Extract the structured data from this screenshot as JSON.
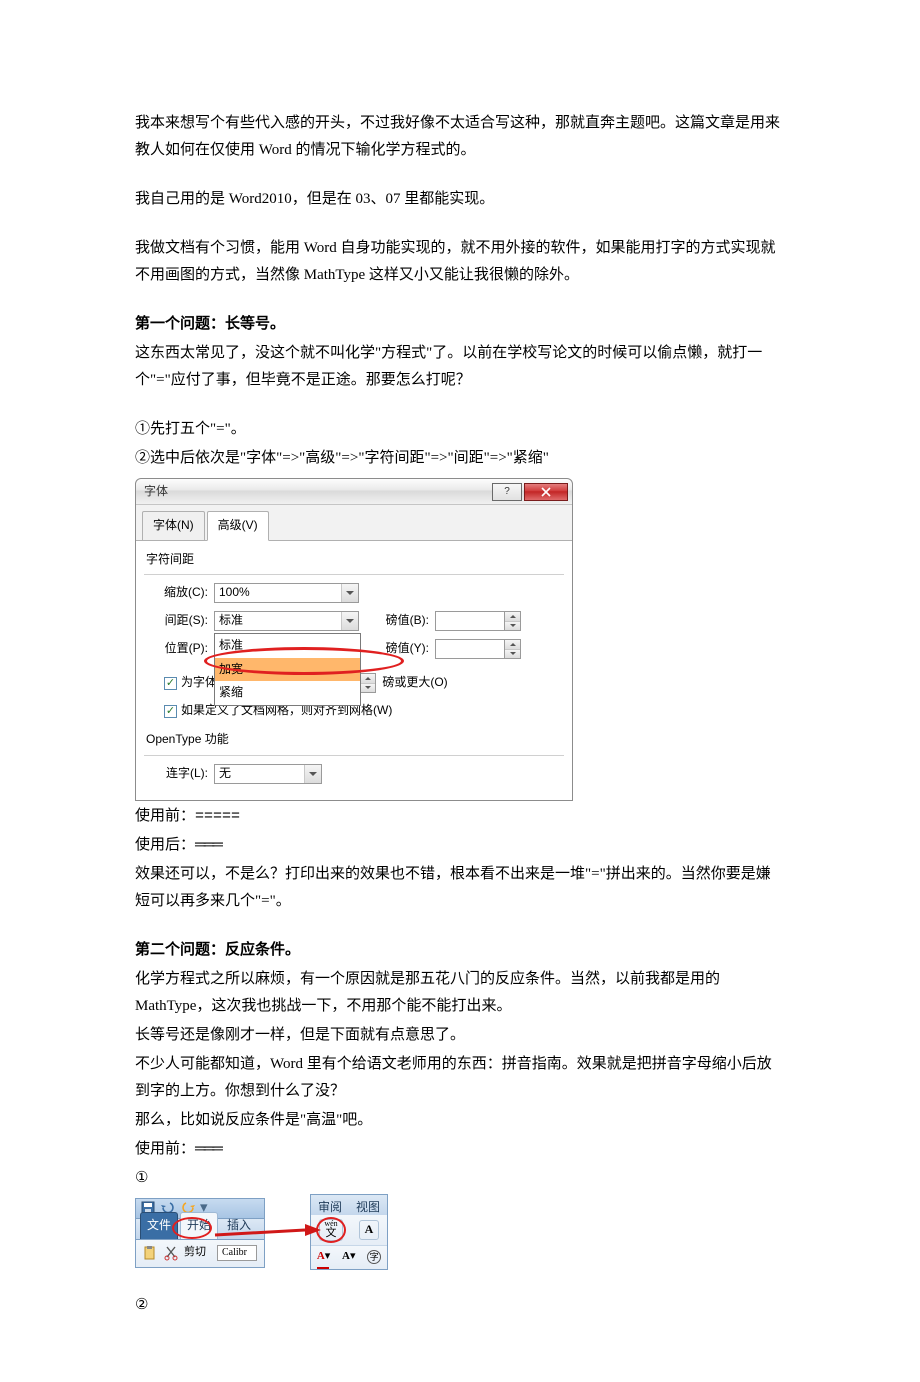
{
  "paragraphs": {
    "p1": "我本来想写个有些代入感的开头，不过我好像不太适合写这种，那就直奔主题吧。这篇文章是用来教人如何在仅使用 Word 的情况下输化学方程式的。",
    "p2": "我自己用的是 Word2010，但是在 03、07 里都能实现。",
    "p3": "我做文档有个习惯，能用 Word 自身功能实现的，就不用外接的软件，如果能用打字的方式实现就不用画图的方式，当然像 MathType 这样又小又能让我很懒的除外。"
  },
  "q1": {
    "title": "第一个问题：长等号。",
    "text": "这东西太常见了，没这个就不叫化学\"方程式\"了。以前在学校写论文的时候可以偷点懒，就打一个\"=\"应付了事，但毕竟不是正途。那要怎么打呢？",
    "step1": "①先打五个\"=\"。",
    "step2": "②选中后依次是\"字体\"=>\"高级\"=>\"字符间距\"=>\"间距\"=>\"紧缩\"",
    "before_label": "使用前：",
    "before_value": "=====",
    "after_label": "使用后：",
    "after_value": "═══",
    "after_text": "效果还可以，不是么？打印出来的效果也不错，根本看不出来是一堆\"=\"拼出来的。当然你要是嫌短可以再多来几个\"=\"。"
  },
  "dialog": {
    "title": "字体",
    "tab_font": "字体(N)",
    "tab_advanced": "高级(V)",
    "group_spacing": "字符间距",
    "label_scale": "缩放(C):",
    "value_scale": "100%",
    "label_spacing": "间距(S):",
    "value_spacing": "标准",
    "label_position": "位置(P):",
    "value_position": "标准",
    "dropdown_opt1": "标准",
    "dropdown_opt2": "加宽",
    "dropdown_opt3": "紧缩",
    "label_pointb": "磅值(B):",
    "label_pointy": "磅值(Y):",
    "chk_kerning": "为字体调整字间距(K):",
    "chk_kerning_suffix": "磅或更大(O)",
    "chk_grid": "如果定义了文档网格，则对齐到网格(W)",
    "group_opentype": "OpenType 功能",
    "label_ligature": "连字(L):",
    "value_ligature": "无"
  },
  "q2": {
    "title": "第二个问题：反应条件。",
    "text1": "化学方程式之所以麻烦，有一个原因就是那五花八门的反应条件。当然，以前我都是用的MathType，这次我也挑战一下，不用那个能不能打出来。",
    "text2": "长等号还是像刚才一样，但是下面就有点意思了。",
    "text3": "不少人可能都知道，Word 里有个给语文老师用的东西：拼音指南。效果就是把拼音字母缩小后放到字的上方。你想到什么了没？",
    "text4": "那么，比如说反应条件是\"高温\"吧。",
    "before_label": "使用前：",
    "before_value": "═══",
    "step1": "①",
    "step2": "②"
  },
  "ribbon": {
    "tab_file": "文件",
    "tab_home": "开始",
    "tab_insert": "插入",
    "cut": "剪切",
    "fontbox": "Calibr",
    "tab_review": "审阅",
    "tab_view": "视图",
    "wen": "wén",
    "wenchar": "文"
  }
}
